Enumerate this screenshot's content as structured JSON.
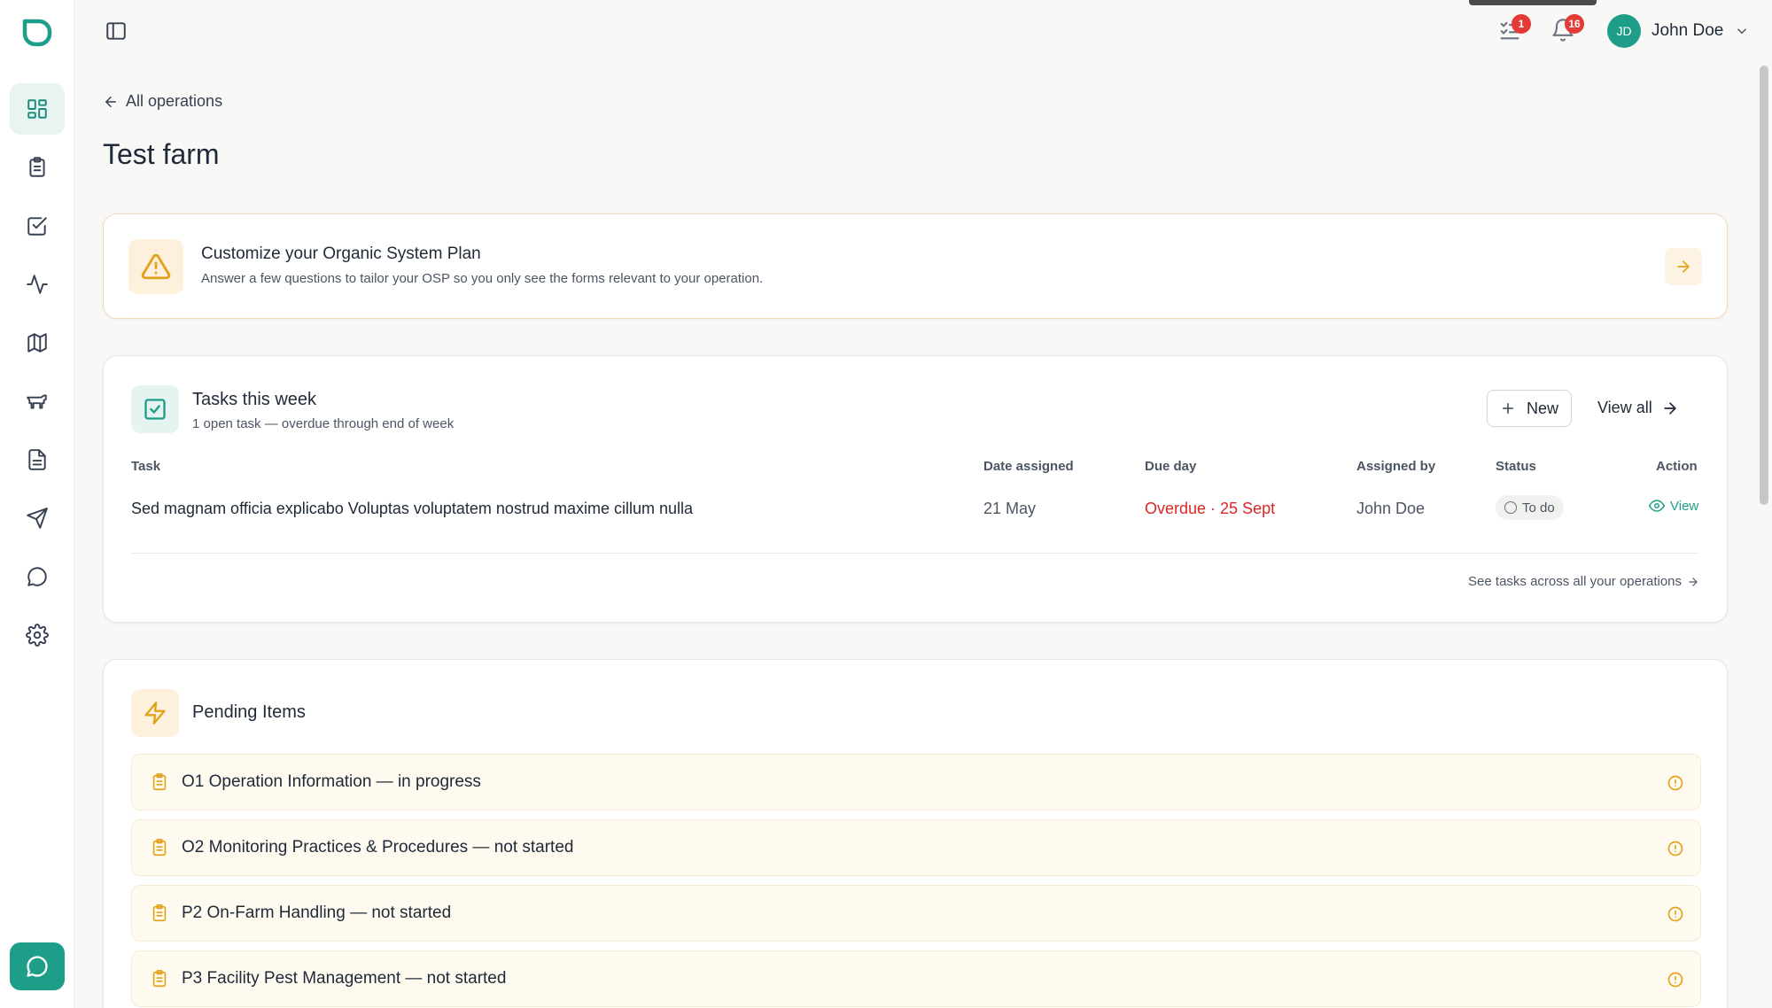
{
  "sidebar": {
    "items": [
      {
        "name": "dashboard-icon",
        "active": true
      },
      {
        "name": "clipboard-icon",
        "active": false
      },
      {
        "name": "checkbox-icon",
        "active": false
      },
      {
        "name": "activity-icon",
        "active": false
      },
      {
        "name": "map-icon",
        "active": false
      },
      {
        "name": "livestock-icon",
        "active": false
      },
      {
        "name": "document-icon",
        "active": false
      },
      {
        "name": "send-icon",
        "active": false
      },
      {
        "name": "message-icon",
        "active": false
      },
      {
        "name": "settings-icon",
        "active": false
      }
    ],
    "chat_button_icon": "chat-icon"
  },
  "header": {
    "tasks_badge": "1",
    "notifications_badge": "16",
    "user": {
      "initials": "JD",
      "name": "John Doe"
    }
  },
  "page": {
    "back_label": "All operations",
    "title": "Test farm"
  },
  "osp_banner": {
    "title": "Customize your Organic System Plan",
    "description": "Answer a few questions to tailor your OSP so you only see the forms relevant to your operation."
  },
  "tasks": {
    "title": "Tasks this week",
    "subtitle": "1 open task — overdue through end of week",
    "new_label": "New",
    "view_all_label": "View all",
    "columns": {
      "task": "Task",
      "date_assigned": "Date assigned",
      "due_day": "Due day",
      "assigned_by": "Assigned by",
      "status": "Status",
      "action": "Action"
    },
    "rows": [
      {
        "task": "Sed magnam officia explicabo Voluptas voluptatem nostrud maxime cillum nulla",
        "date_assigned": "21 May",
        "due": "Overdue · 25 Sept",
        "assigned_by": "John Doe",
        "status": "To do",
        "action": "View"
      }
    ],
    "see_all_operations": "See tasks across all your operations"
  },
  "pending": {
    "title": "Pending Items",
    "items": [
      "O1 Operation Information — in progress",
      "O2 Monitoring Practices & Procedures — not started",
      "P2 On-Farm Handling — not started",
      "P3 Facility Pest Management — not started"
    ]
  },
  "colors": {
    "brand": "#1e9e89",
    "warning": "#e2a21a",
    "danger": "#dc2626"
  }
}
